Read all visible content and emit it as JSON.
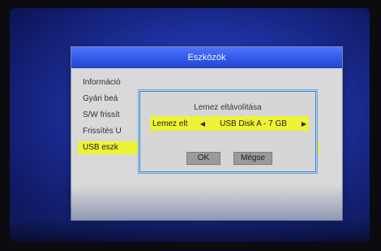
{
  "window": {
    "title": "Eszközök"
  },
  "menu": {
    "items": [
      {
        "label": "Információ"
      },
      {
        "label": "Gyári beá"
      },
      {
        "label": "S/W frissít"
      },
      {
        "label": "Frissítés U"
      },
      {
        "label": "USB eszk"
      }
    ],
    "selected_index": 4
  },
  "dialog": {
    "title": "Lemez eltávolítása",
    "row_label": "Lemez elt",
    "row_value": "USB Disk A - 7 GB",
    "ok_label": "OK",
    "cancel_label": "Mégse"
  },
  "colors": {
    "title_bar": "#3158e8",
    "highlight": "#eef335",
    "dialog_border": "#2d7fd8",
    "background": "#1d2f9c"
  }
}
